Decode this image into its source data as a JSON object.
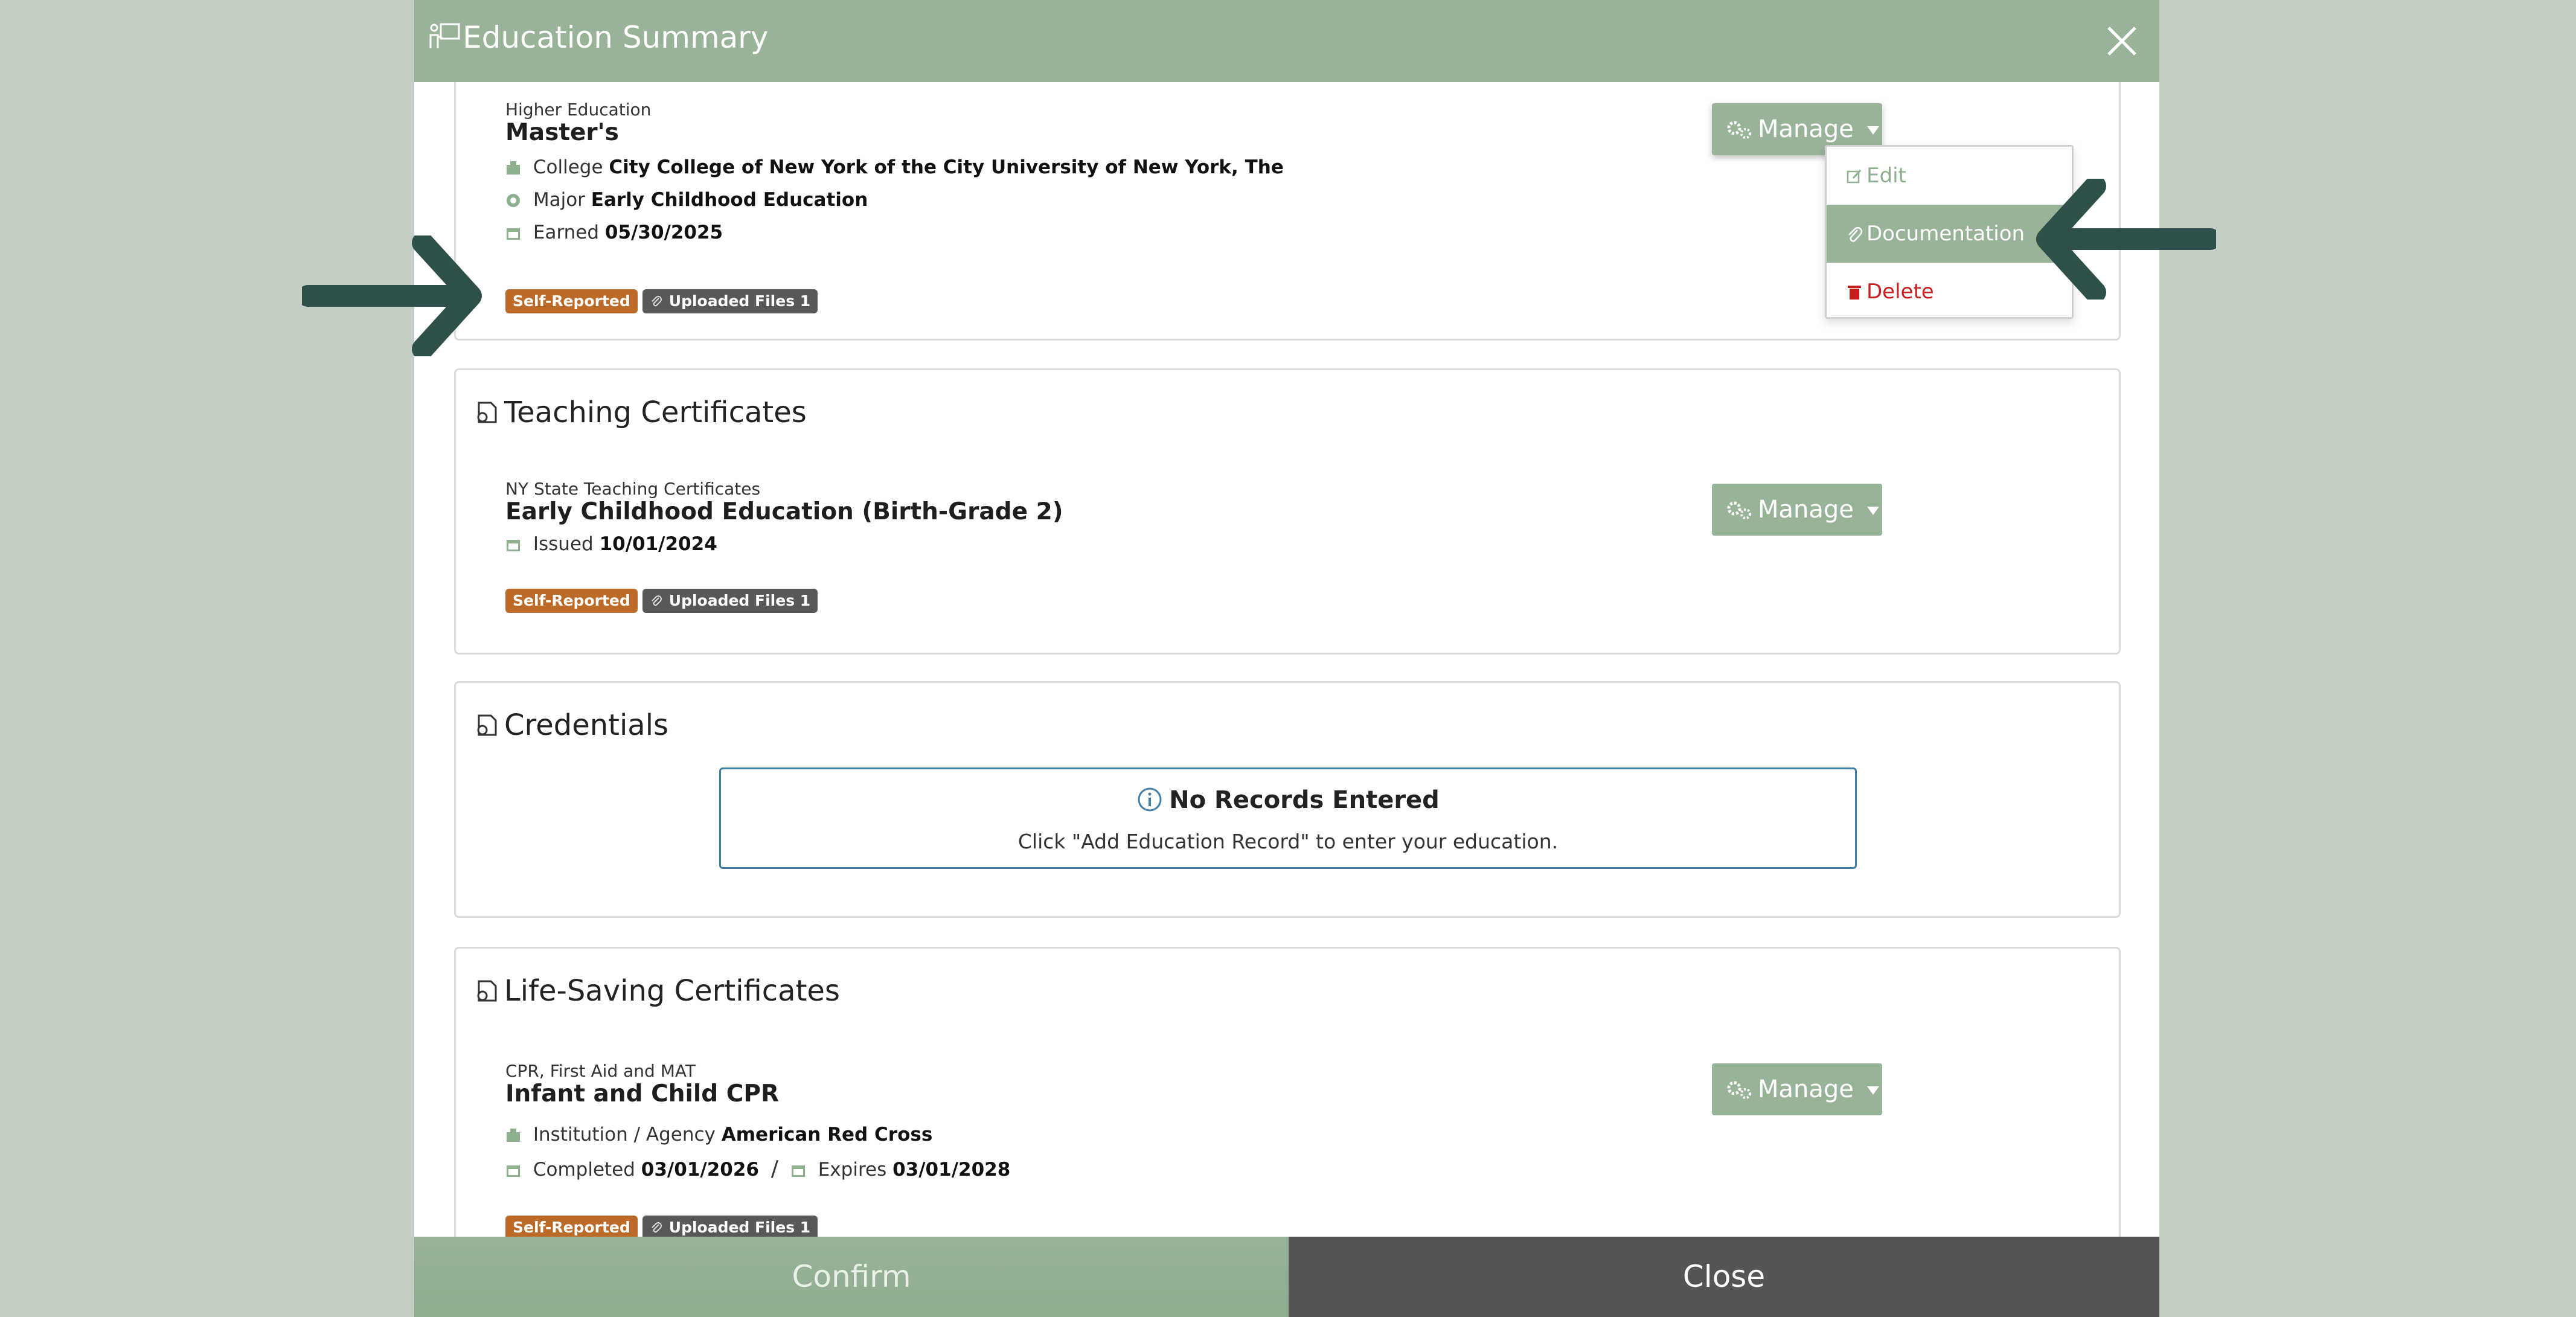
{
  "modal": {
    "title": "Education Summary"
  },
  "colors": {
    "accent": "#98b398",
    "self_reported": "#bb6a28",
    "files_badge": "#585858",
    "delete": "#c81e1e",
    "info_border": "#3f7fa6",
    "arrow": "#2f4f4a"
  },
  "icons": {
    "header": "certificate-user-icon",
    "close": "close-icon",
    "manage": "gears-icon",
    "caret": "chevron-down-icon"
  },
  "higher_education": {
    "record": {
      "subtitle": "Higher Education",
      "title": "Master's",
      "college_label": "College",
      "college_value": "City College of New York of the City University of New York, The",
      "major_label": "Major",
      "major_value": "Early Childhood Education",
      "earned_label": "Earned",
      "earned_value": "05/30/2025",
      "badge_self": "Self-Reported",
      "badge_files": "Uploaded Files 1",
      "manage_label": "Manage"
    },
    "dropdown": {
      "edit": "Edit",
      "documentation": "Documentation",
      "delete": "Delete"
    }
  },
  "teaching_certificates": {
    "title": "Teaching Certificates",
    "record": {
      "subtitle": "NY State Teaching Certificates",
      "title": "Early Childhood Education (Birth-Grade 2)",
      "issued_label": "Issued",
      "issued_value": "10/01/2024",
      "badge_self": "Self-Reported",
      "badge_files": "Uploaded Files 1",
      "manage_label": "Manage"
    }
  },
  "credentials": {
    "title": "Credentials",
    "empty_title": "No Records Entered",
    "empty_text": "Click \"Add Education Record\" to enter your education."
  },
  "life_saving": {
    "title": "Life-Saving Certificates",
    "record": {
      "subtitle": "CPR, First Aid and MAT",
      "title": "Infant and Child CPR",
      "institution_label": "Institution / Agency",
      "institution_value": "American Red Cross",
      "completed_label": "Completed",
      "completed_value": "03/01/2026",
      "slash": "/",
      "expires_label": "Expires",
      "expires_value": "03/01/2028",
      "badge_self": "Self-Reported",
      "badge_files": "Uploaded Files 1",
      "manage_label": "Manage"
    }
  },
  "footer": {
    "confirm": "Confirm",
    "close": "Close"
  }
}
